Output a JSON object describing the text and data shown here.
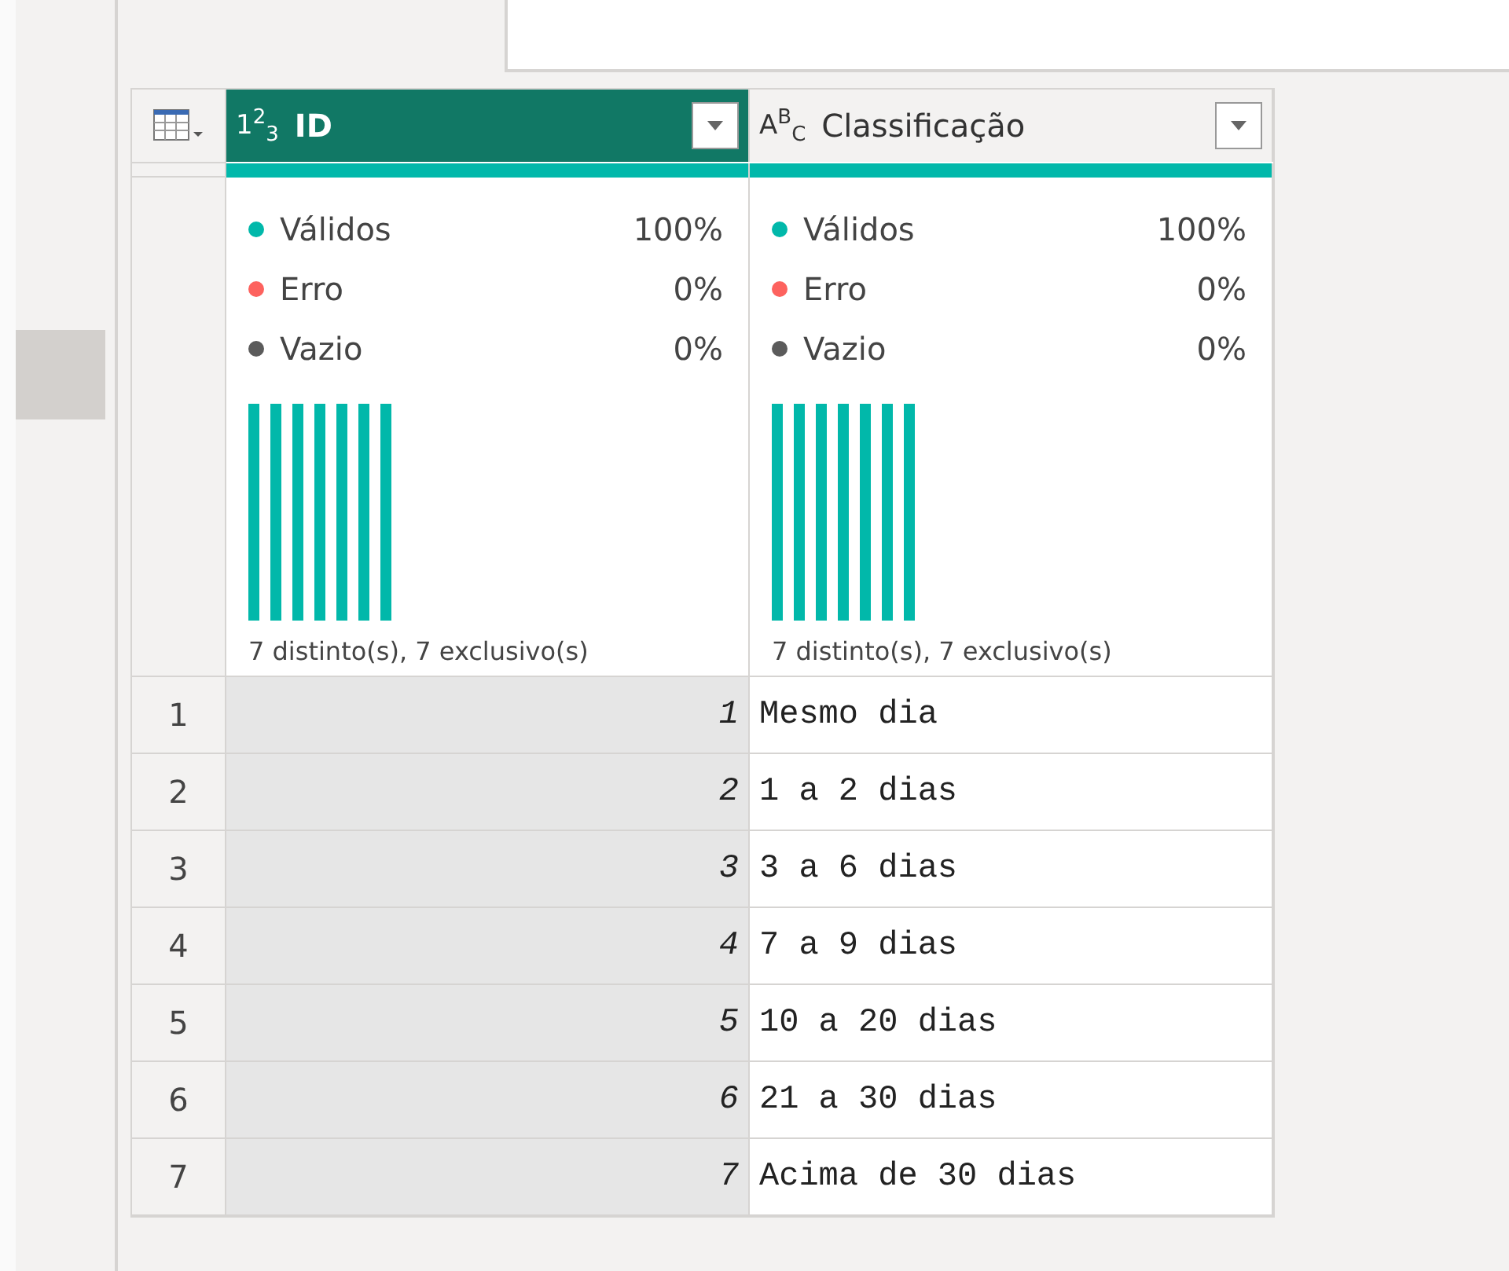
{
  "columns": [
    {
      "type_label": "1$^{2}$$_{3}$",
      "name": "ID",
      "selected": true,
      "kind": "number",
      "quality": {
        "level": 1
      },
      "stats": [
        {
          "label": "Válidos",
          "value": "100%",
          "color": "#01b8aa"
        },
        {
          "label": "Erro",
          "value": "0%",
          "color": "#fd625e"
        },
        {
          "label": "Vazio",
          "value": "0%",
          "color": "#5b5b5b"
        }
      ],
      "distribution_caption": "7 distinto(s), 7 exclusivo(s)"
    },
    {
      "type_label": "A$^{B}$$_{C}$",
      "name": "Classificação",
      "selected": false,
      "kind": "text",
      "quality": {
        "level": 1
      },
      "stats": [
        {
          "label": "Válidos",
          "value": "100%",
          "color": "#01b8aa"
        },
        {
          "label": "Erro",
          "value": "0%",
          "color": "#fd625e"
        },
        {
          "label": "Vazio",
          "value": "0%",
          "color": "#5b5b5b"
        }
      ],
      "distribution_caption": "7 distinto(s), 7 exclusivo(s)"
    }
  ],
  "rows": [
    {
      "number": "1",
      "cells": [
        "1",
        "Mesmo dia"
      ]
    },
    {
      "number": "2",
      "cells": [
        "2",
        "1 a 2 dias"
      ]
    },
    {
      "number": "3",
      "cells": [
        "3",
        "3 a 6 dias"
      ]
    },
    {
      "number": "4",
      "cells": [
        "4",
        "7 a 9 dias"
      ]
    },
    {
      "number": "5",
      "cells": [
        "5",
        "10 a 20 dias"
      ]
    },
    {
      "number": "6",
      "cells": [
        "6",
        "21 a 30 dias"
      ]
    },
    {
      "number": "7",
      "cells": [
        "7",
        "Acima de 30 dias"
      ]
    }
  ]
}
